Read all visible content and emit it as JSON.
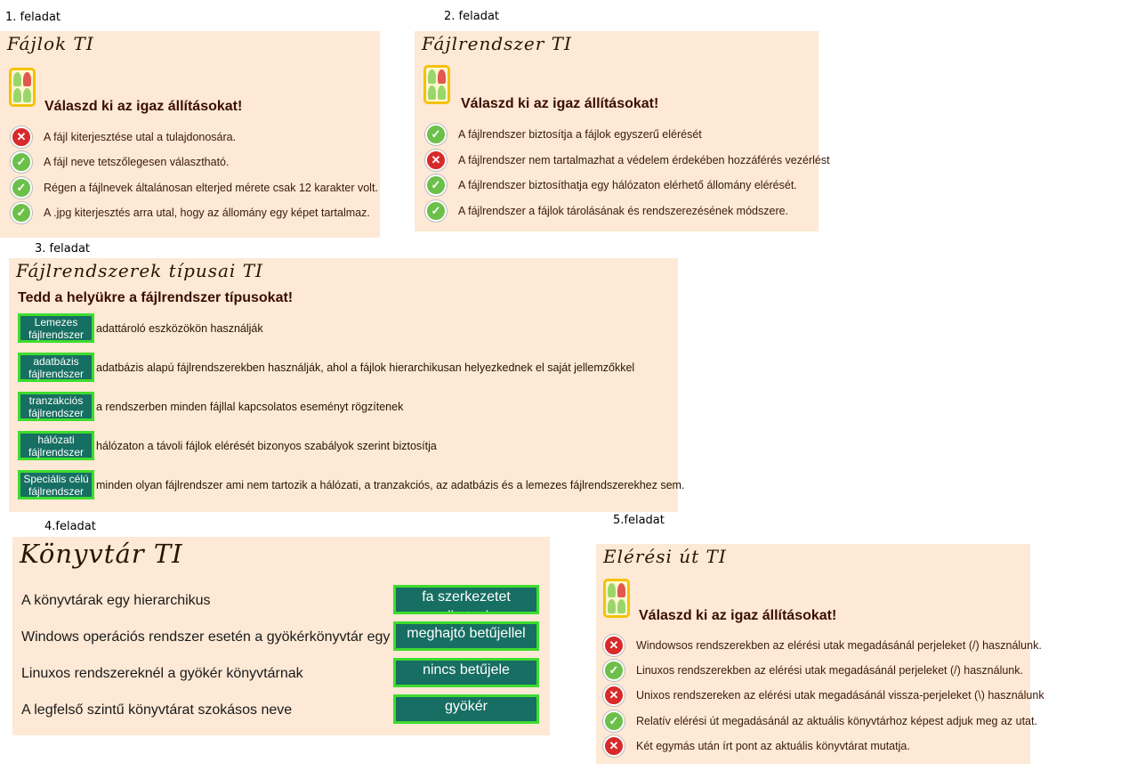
{
  "tasks": [
    {
      "label": "1. feladat"
    },
    {
      "label": "2. feladat"
    },
    {
      "label": "3. feladat"
    },
    {
      "label": "4.feladat"
    },
    {
      "label": "5.feladat"
    }
  ],
  "panel1": {
    "title": "Fájlok TI",
    "question": "Válaszd ki az igaz állításokat!",
    "items": [
      {
        "text": "A fájl kiterjesztése utal a tulajdonosára.",
        "correct": false
      },
      {
        "text": "A fájl neve tetszőlegesen választható.",
        "correct": true
      },
      {
        "text": "Régen a fájlnevek általánosan elterjed mérete csak 12 karakter volt.",
        "correct": true
      },
      {
        "text": "A .jpg kiterjesztés arra utal, hogy az állomány egy képet tartalmaz.",
        "correct": true
      }
    ]
  },
  "panel2": {
    "title": "Fájlrendszer TI",
    "question": "Válaszd ki az igaz állításokat!",
    "items": [
      {
        "text": "A fájlrendszer biztosítja a fájlok egyszerű elérését",
        "correct": true
      },
      {
        "text": "A fájlrendszer nem tartalmazhat a védelem érdekében hozzáférés vezérlést",
        "correct": false
      },
      {
        "text": "A fájlrendszer biztosíthatja egy hálózaton elérhető állomány elérését.",
        "correct": true
      },
      {
        "text": "A fájlrendszer a fájlok tárolásának és rendszerezésének módszere.",
        "correct": true
      }
    ]
  },
  "panel3": {
    "title": "Fájlrendszerek típusai TI",
    "question": "Tedd a helyükre a fájlrendszer típusokat!",
    "items": [
      {
        "box1": "Lemezes",
        "box2": "fájlrendszer",
        "text": "adattároló eszközökön használják"
      },
      {
        "box1": "adatbázis",
        "box2": "fájlrendszer",
        "text": "adatbázis alapú fájlrendszerekben használják, ahol a fájlok hierarchikusan helyezkednek el saját jellemzőkkel"
      },
      {
        "box1": "tranzakciós",
        "box2": "fájlrendszer",
        "text": "a rendszerben minden fájllal kapcsolatos eseményt rögzítenek"
      },
      {
        "box1": "hálózati",
        "box2": "fájlrendszer",
        "text": "hálózaton a távoli fájlok elérését bizonyos szabályok szerint biztosítja"
      },
      {
        "box1": "Speciális célú",
        "box2": "fájlrendszer",
        "text": "minden olyan fájlrendszer ami nem tartozik a hálózati, a tranzakciós, az adatbázis és a lemezes fájlrendszerekhez sem."
      }
    ]
  },
  "panel4": {
    "title": "Könyvtár TI",
    "items": [
      {
        "text": "A könyvtárak egy hierarchikus",
        "answer": "fa szerkezetet alkotnak"
      },
      {
        "text": "Windows operációs rendszer esetén a gyökérkönyvtár egy",
        "answer": "meghajtó betűjellel"
      },
      {
        "text": "Linuxos rendszereknél a gyökér könyvtárnak",
        "answer": "nincs betűjele"
      },
      {
        "text": "A legfelső szintű könyvtárat szokásos neve",
        "answer": "gyökér"
      }
    ]
  },
  "panel5": {
    "title": "Elérési út TI",
    "question": "Válaszd ki az igaz állításokat!",
    "items": [
      {
        "text": "Windowsos rendszerekben az elérési utak megadásánál perjeleket (/) használunk.",
        "correct": false
      },
      {
        "text": "Linuxos rendszerekben az elérési utak megadásánál perjeleket (/) használunk.",
        "correct": true
      },
      {
        "text": "Unixos rendszereken az elérési utak megadásánál vissza-perjeleket (\\) használunk",
        "correct": false
      },
      {
        "text": "Relatív elérési út megadásánál az aktuális könyvtárhoz képest adjuk meg az utat.",
        "correct": true
      },
      {
        "text": "Két egymás után írt pont az aktuális könyvtárat mutatja.",
        "correct": false
      }
    ]
  },
  "colors": {
    "panel_bg": "#fde9d5",
    "box_bg": "#176e62",
    "box_border": "#3edc2e",
    "ok": "#6cc04a",
    "wrong": "#d82a2a"
  }
}
